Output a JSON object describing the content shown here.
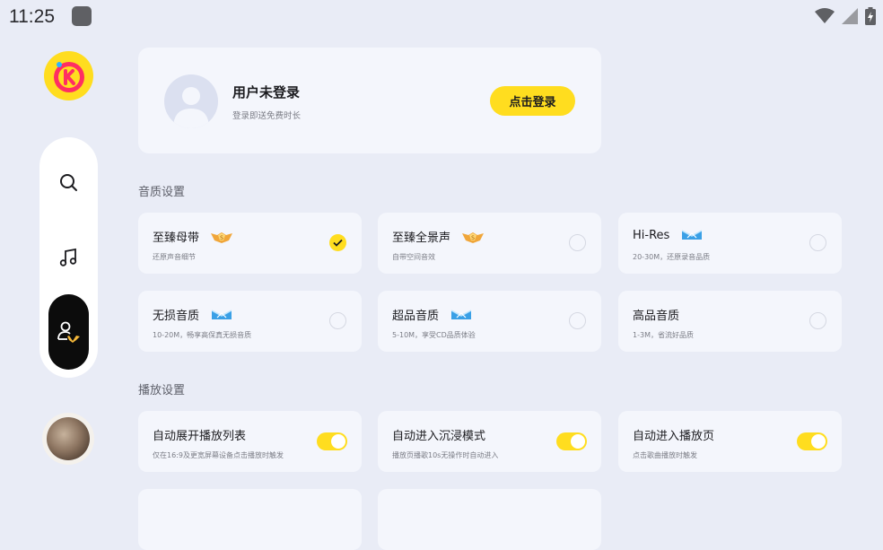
{
  "status_bar": {
    "time": "11:25"
  },
  "user": {
    "name": "用户未登录",
    "subtitle": "登录即送免费时长",
    "login_label": "点击登录"
  },
  "quality": {
    "title": "音质设置",
    "options": [
      {
        "name": "至臻母带",
        "desc": "还原声音细节",
        "badge": "gold",
        "selected": true
      },
      {
        "name": "至臻全景声",
        "desc": "自带空间音效",
        "badge": "gold",
        "selected": false
      },
      {
        "name": "Hi-Res",
        "desc": "20-30M，还原录音品质",
        "badge": "blue",
        "selected": false
      },
      {
        "name": "无损音质",
        "desc": "10-20M，畅享高保真无损音质",
        "badge": "blue",
        "selected": false
      },
      {
        "name": "超品音质",
        "desc": "5-10M，享受CD品质体验",
        "badge": "blue",
        "selected": false
      },
      {
        "name": "高品音质",
        "desc": "1-3M，省流好品质",
        "badge": "",
        "selected": false
      }
    ]
  },
  "playback": {
    "title": "播放设置",
    "options": [
      {
        "name": "自动展开播放列表",
        "desc": "仅在16:9及更宽屏幕设备点击播放时触发",
        "on": true
      },
      {
        "name": "自动进入沉浸模式",
        "desc": "播放页播歌10s无操作时自动进入",
        "on": true
      },
      {
        "name": "自动进入播放页",
        "desc": "点击歌曲播放时触发",
        "on": true
      }
    ]
  },
  "colors": {
    "accent": "#ffdd1f",
    "background": "#e9ecf6",
    "card": "#f4f6fc"
  }
}
